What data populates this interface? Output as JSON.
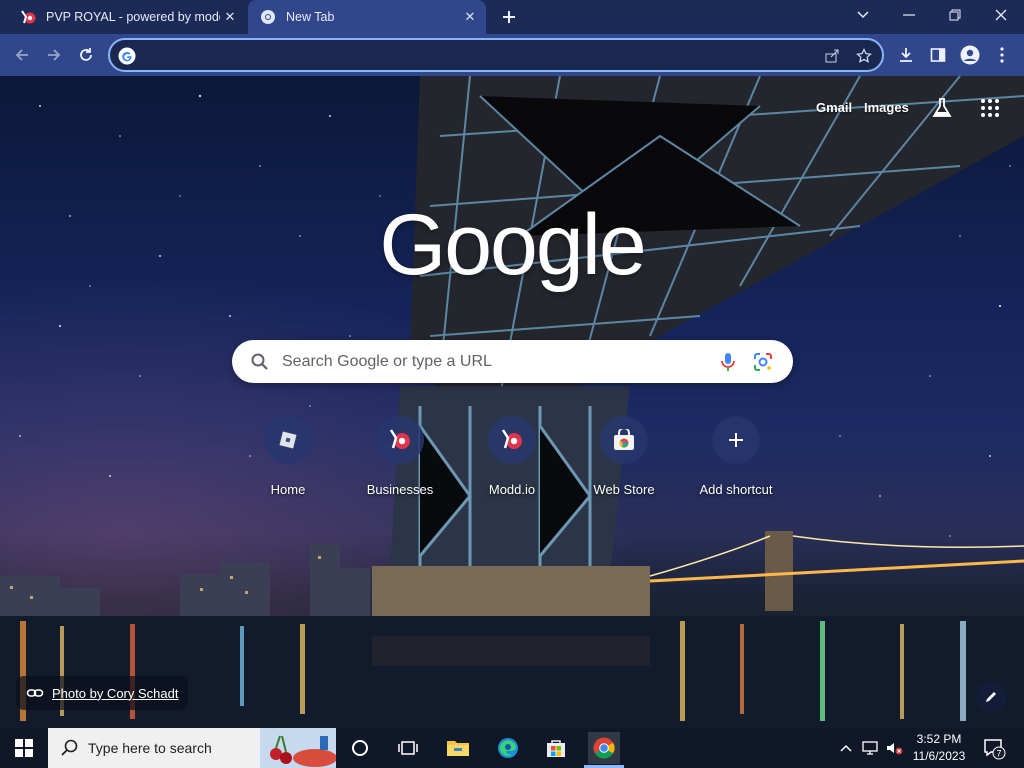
{
  "browser": {
    "tabs": [
      {
        "title": "PVP ROYAL - powered by modd.io",
        "active": false,
        "favicon": "modd-favicon-icon"
      },
      {
        "title": "New Tab",
        "active": true,
        "favicon": "chrome-favicon-icon"
      }
    ],
    "window_controls": [
      "tab-search-icon",
      "minimize-icon",
      "restore-icon",
      "close-icon"
    ],
    "omnibox": {
      "value": "",
      "placeholder": ""
    },
    "toolbar_icons": [
      "back-icon",
      "forward-icon",
      "reload-icon",
      "share-icon",
      "star-icon",
      "download-icon",
      "side-panel-icon",
      "profile-icon",
      "menu-icon"
    ]
  },
  "ntp": {
    "top_links": {
      "gmail": "Gmail",
      "images": "Images"
    },
    "logo_text": "Google",
    "search": {
      "placeholder": "Search Google or type a URL"
    },
    "shortcuts": [
      {
        "label": "Home",
        "icon": "roblox-icon"
      },
      {
        "label": "Businesses",
        "icon": "modd-icon"
      },
      {
        "label": "Modd.io",
        "icon": "modd-icon"
      },
      {
        "label": "Web Store",
        "icon": "webstore-icon"
      },
      {
        "label": "Add shortcut",
        "icon": "plus-icon"
      }
    ],
    "attribution": "Photo by Cory Schadt"
  },
  "taskbar": {
    "search_placeholder": "Type here to search",
    "apps": [
      "cortana-icon",
      "task-view-icon",
      "file-explorer-icon",
      "edge-icon",
      "store-icon",
      "chrome-icon"
    ],
    "clock_time": "3:52 PM",
    "clock_date": "11/6/2023",
    "notification_count": "7"
  }
}
